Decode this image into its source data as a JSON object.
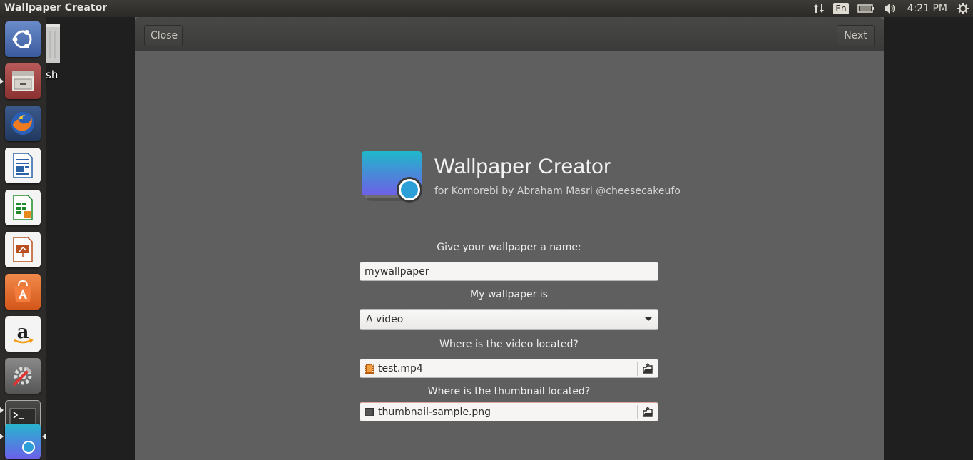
{
  "topbar": {
    "app_title": "Wallpaper Creator",
    "keyboard_lang": "En",
    "clock": "4:21 PM"
  },
  "desktop": {
    "trash_label": "sh"
  },
  "dialog": {
    "close_label": "Close",
    "next_label": "Next",
    "app_title": "Wallpaper Creator",
    "app_subtitle": "for Komorebi by Abraham Masri @cheesecakeufo",
    "name_label": "Give your wallpaper a name:",
    "name_value": "mywallpaper",
    "type_label": "My wallpaper is",
    "type_value": "A video",
    "video_label": "Where is the video located?",
    "video_file": "test.mp4",
    "thumb_label": "Where is the thumbnail located?",
    "thumb_file": "thumbnail-sample.png"
  },
  "launcher": {
    "items": [
      "ubuntu-dash",
      "files",
      "firefox",
      "libreoffice-writer",
      "libreoffice-calc",
      "libreoffice-impress",
      "ubuntu-software",
      "amazon",
      "system-settings",
      "terminal",
      "wallpaper-creator"
    ]
  },
  "colors": {
    "window_bg": "#5f5f5f",
    "header_bg": "#3f3f3d",
    "logo_gradient_top": "#1fb8c9",
    "logo_gradient_bottom": "#6f5fe6"
  }
}
